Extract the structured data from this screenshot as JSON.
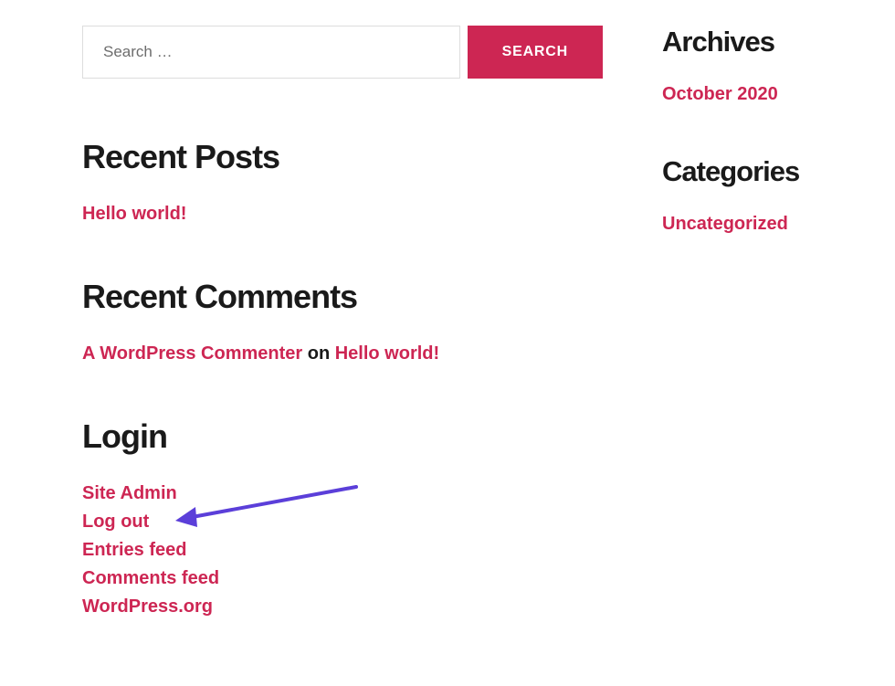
{
  "search": {
    "placeholder": "Search …",
    "button_label": "SEARCH"
  },
  "recent_posts": {
    "heading": "Recent Posts",
    "items": [
      {
        "label": "Hello world!"
      }
    ]
  },
  "recent_comments": {
    "heading": "Recent Comments",
    "items": [
      {
        "author": "A WordPress Commenter",
        "connector": " on ",
        "post": "Hello world!"
      }
    ]
  },
  "login": {
    "heading": "Login",
    "items": [
      {
        "label": "Site Admin"
      },
      {
        "label": "Log out"
      },
      {
        "label": "Entries feed"
      },
      {
        "label": "Comments feed"
      },
      {
        "label": "WordPress.org"
      }
    ]
  },
  "archives": {
    "heading": "Archives",
    "items": [
      {
        "label": "October 2020"
      }
    ]
  },
  "categories": {
    "heading": "Categories",
    "items": [
      {
        "label": "Uncategorized"
      }
    ]
  }
}
